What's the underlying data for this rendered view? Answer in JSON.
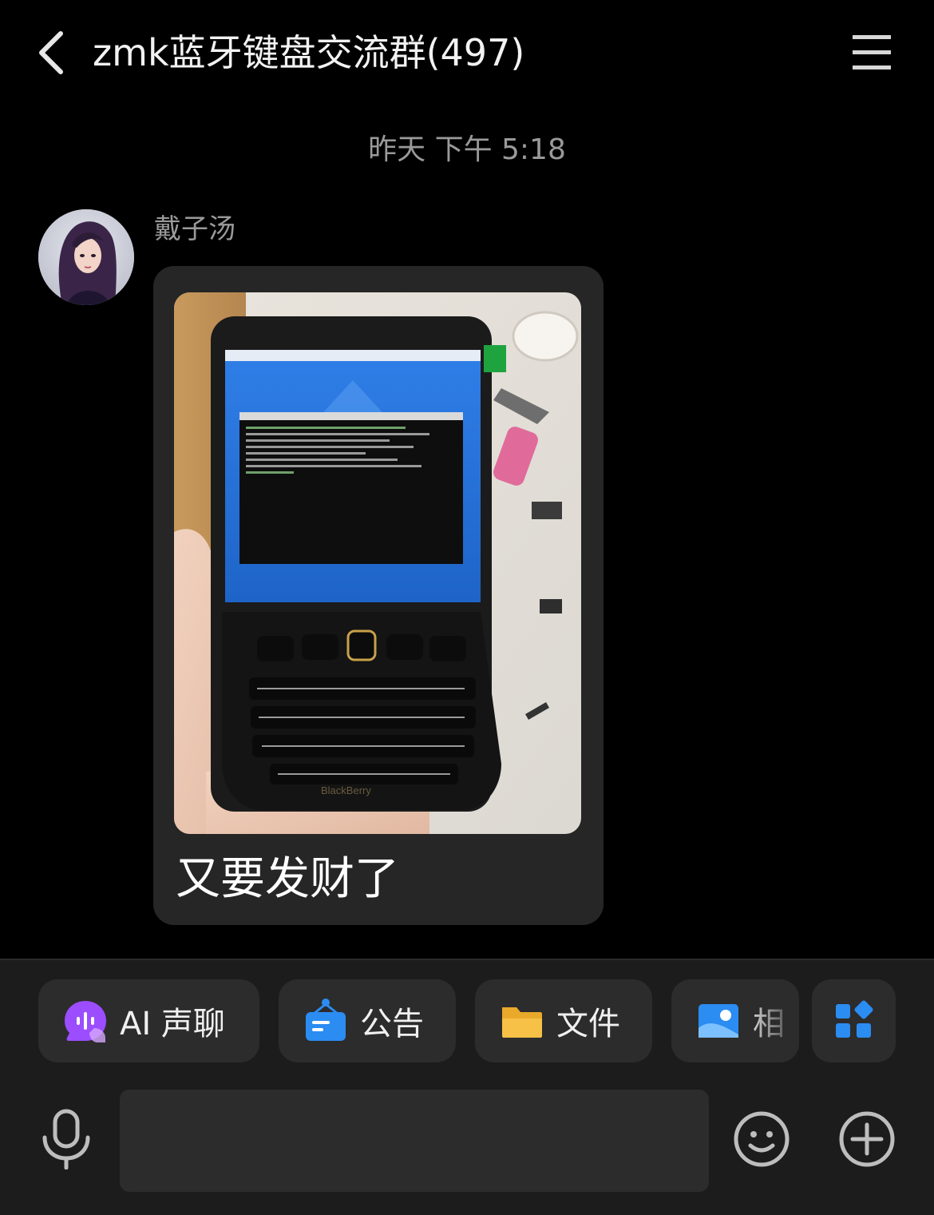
{
  "header": {
    "title": "zmk蓝牙键盘交流群(497)",
    "back_icon": "chevron-left-icon",
    "menu_icon": "hamburger-menu-icon"
  },
  "timestamp": "昨天 下午 5:18",
  "message": {
    "sender": "戴子汤",
    "text": "又要发财了",
    "image_alt": "BlackBerry handheld device with blue desktop and terminal window"
  },
  "quick_actions": [
    {
      "label": "AI 声聊",
      "icon": "ai-voice-chat-icon"
    },
    {
      "label": "公告",
      "icon": "announcement-icon"
    },
    {
      "label": "文件",
      "icon": "folder-icon"
    },
    {
      "label": "相",
      "icon": "album-icon"
    },
    {
      "label": "",
      "icon": "apps-grid-icon"
    }
  ],
  "input": {
    "value": "",
    "placeholder": ""
  },
  "colors": {
    "background": "#000000",
    "bubble": "#262626",
    "panel": "#1c1c1c",
    "chip": "#2c2c2c",
    "accent_blue": "#2b8cf2",
    "ai_purple": "#9b4dff",
    "folder_yellow": "#f7c147"
  }
}
